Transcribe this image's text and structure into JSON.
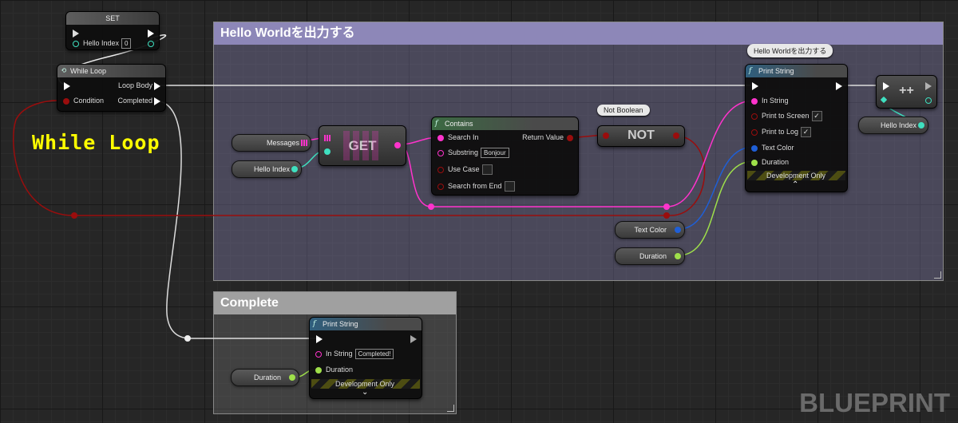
{
  "comments": {
    "main_title": "Hello Worldを出力する",
    "complete_title": "Complete"
  },
  "set_node": {
    "title": "SET",
    "var_label": "Hello Index",
    "var_value": "0"
  },
  "while_loop": {
    "title": "While Loop",
    "condition": "Condition",
    "loop_body": "Loop Body",
    "completed": "Completed"
  },
  "messages_var": {
    "label": "Messages"
  },
  "hello_index_var": {
    "label": "Hello Index"
  },
  "get_node": {
    "label": "GET"
  },
  "contains": {
    "title": "Contains",
    "search_in": "Search In",
    "substring": "Substring",
    "substring_value": "Bonjour",
    "use_case": "Use Case",
    "search_from_end": "Search from End",
    "return_value": "Return Value"
  },
  "not_node": {
    "label": "NOT",
    "bubble": "Not Boolean"
  },
  "print_string_main": {
    "title": "Print String",
    "bubble": "Hello Worldを出力する",
    "in_string": "In String",
    "print_to_screen": "Print to Screen",
    "print_to_log": "Print to Log",
    "text_color": "Text Color",
    "duration": "Duration",
    "dev_only": "Development Only",
    "check": "✓"
  },
  "increment": {
    "label": "++",
    "var_label": "Hello Index"
  },
  "text_color_var": {
    "label": "Text Color"
  },
  "duration_var": {
    "label": "Duration"
  },
  "print_string_complete": {
    "title": "Print String",
    "in_string": "In String",
    "in_string_value": "Completed!",
    "duration": "Duration",
    "dev_only": "Development Only"
  },
  "duration_var2": {
    "label": "Duration"
  },
  "annotation": "While Loop",
  "watermark": "BLUEPRINT",
  "colors": {
    "exec": "#ffffff",
    "string": "#ff33cc",
    "int": "#3fe0c0",
    "bool": "#8b0000",
    "struct": "#1f5fd6",
    "float": "#9fe04a",
    "array": "#d040b0"
  }
}
